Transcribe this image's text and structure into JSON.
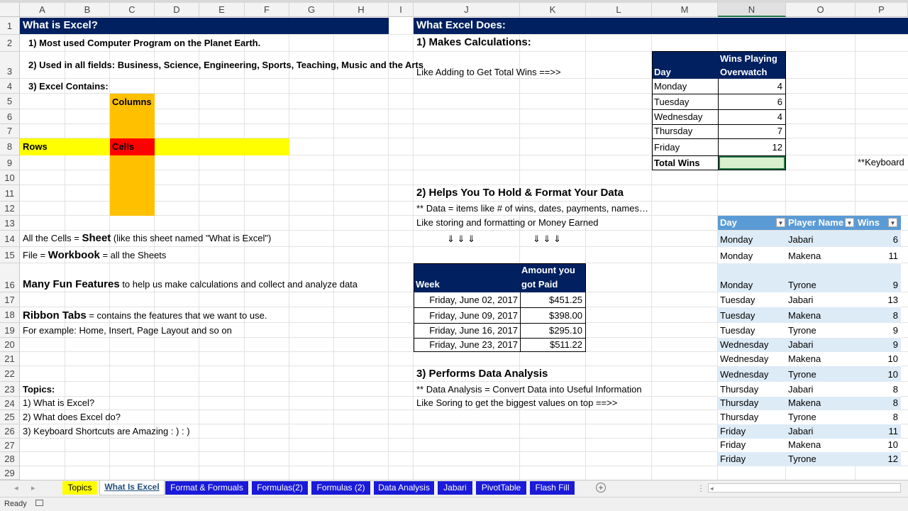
{
  "columns": [
    "A",
    "B",
    "C",
    "D",
    "E",
    "F",
    "G",
    "H",
    "I",
    "J",
    "K",
    "L",
    "M",
    "N",
    "O",
    "P"
  ],
  "rows": [
    "1",
    "2",
    "3",
    "4",
    "5",
    "6",
    "7",
    "8",
    "9",
    "10",
    "11",
    "12",
    "13",
    "14",
    "15",
    "16",
    "17",
    "18",
    "19",
    "20",
    "21",
    "22",
    "23",
    "24",
    "25",
    "26",
    "27",
    "28",
    "29"
  ],
  "left": {
    "title": "What is Excel?",
    "line2": "1) Most used Computer Program on the Planet Earth.",
    "line3": "2) Used in all fields: Business, Science, Engineering, Sports, Teaching, Music and the Arts",
    "line4": "3) Excel Contains:",
    "columns_label": "Columns",
    "rows_label": "Rows",
    "cells_label": "Cells",
    "sheet_pre": "All the Cells = ",
    "sheet_word": "Sheet",
    "sheet_post": " (like this sheet named \"What is Excel\")",
    "workbook_pre": "File = ",
    "workbook_word": "Workbook",
    "workbook_post": " = all the Sheets",
    "features_word": "Many Fun Features",
    "features_post": " to help us make calculations and collect and analyze data",
    "ribbon_word": "Ribbon Tabs",
    "ribbon_post": " = contains the features that we want to use.",
    "example": "For example: Home, Insert, Page Layout and so on",
    "topics_title": "Topics:",
    "topic1": "1) What is Excel?",
    "topic2": "2) What does Excel do?",
    "topic3": "3) Keyboard Shortcuts are Amazing : )  : )"
  },
  "right": {
    "title": "What Excel Does:",
    "s1": "1) Makes Calculations:",
    "s1_note": "Like Adding to Get Total Wins ==>>",
    "s2": "2) Helps You To Hold & Format Your Data",
    "s2_note1": "** Data = items like # of wins, dates, payments, names…",
    "s2_note2": "Like storing and formatting or Money Earned",
    "arrows": "⇓  ⇓  ⇓",
    "arrows2": "⇓  ⇓  ⇓",
    "s3": "3) Performs Data Analysis",
    "s3_note1": "** Data Analysis = Convert Data into Useful Information",
    "s3_note2": "  Like Soring to get the biggest values on top ==>>",
    "keyboard_note": "**Keyboard"
  },
  "wins_table": {
    "h_day": "Day",
    "h_wins1": "Wins Playing",
    "h_wins2": "Overwatch",
    "rows": [
      [
        "Monday",
        "4"
      ],
      [
        "Tuesday",
        "6"
      ],
      [
        "Wednesday",
        "4"
      ],
      [
        "Thursday",
        "7"
      ],
      [
        "Friday",
        "12"
      ]
    ],
    "total_label": "Total Wins"
  },
  "pay_table": {
    "h_week": "Week",
    "h_amt1": "Amount you",
    "h_amt2": "got Paid",
    "rows": [
      [
        "Friday, June 02, 2017",
        "$451.25"
      ],
      [
        "Friday, June 09, 2017",
        "$398.00"
      ],
      [
        "Friday, June 16, 2017",
        "$295.10"
      ],
      [
        "Friday, June 23, 2017",
        "$511.22"
      ]
    ]
  },
  "player_table": {
    "h_day": "Day",
    "h_player": "Player Name",
    "h_wins": "Wins",
    "rows": [
      [
        "Monday",
        "Jabari",
        "6"
      ],
      [
        "Monday",
        "Makena",
        "11"
      ],
      [
        "Monday",
        "Tyrone",
        "9"
      ],
      [
        "Tuesday",
        "Jabari",
        "13"
      ],
      [
        "Tuesday",
        "Makena",
        "8"
      ],
      [
        "Tuesday",
        "Tyrone",
        "9"
      ],
      [
        "Wednesday",
        "Jabari",
        "9"
      ],
      [
        "Wednesday",
        "Makena",
        "10"
      ],
      [
        "Wednesday",
        "Tyrone",
        "10"
      ],
      [
        "Thursday",
        "Jabari",
        "8"
      ],
      [
        "Thursday",
        "Makena",
        "8"
      ],
      [
        "Thursday",
        "Tyrone",
        "8"
      ],
      [
        "Friday",
        "Jabari",
        "11"
      ],
      [
        "Friday",
        "Makena",
        "10"
      ],
      [
        "Friday",
        "Tyrone",
        "12"
      ]
    ]
  },
  "tabs": [
    "Topics",
    "What Is Excel",
    "Format & Formuals",
    "Formulas(2)",
    "Formulas (2)",
    "Data Analysis",
    "Jabari",
    "PivotTable",
    "Flash Fill"
  ],
  "status": {
    "ready": "Ready"
  },
  "colors": {
    "navy": "#002060",
    "yellow": "#ffff00",
    "orange": "#ffc000",
    "red": "#ff0000",
    "table_blue": "#5b9bd5",
    "band": "#ddebf7",
    "tab_blue": "#1a1ad8"
  }
}
